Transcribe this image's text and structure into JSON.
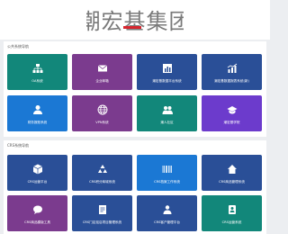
{
  "brand": {
    "logo_text": "潮宏基集团"
  },
  "sections": [
    {
      "title": "公共系统导航",
      "tiles": [
        {
          "label": "OA系统",
          "icon": "org-chart-icon",
          "color": "#12877a"
        },
        {
          "label": "企业邮箱",
          "icon": "mail-icon",
          "color": "#7b3b8e"
        },
        {
          "label": "潮宏基数据平台系统",
          "icon": "bar-chart-icon",
          "color": "#2a4f97"
        },
        {
          "label": "潮宏基数据报表系统(新)",
          "icon": "trend-chart-icon",
          "color": "#2a4f97"
        },
        {
          "label": "财务报账系统",
          "icon": "finance-user-icon",
          "color": "#1b78d4"
        },
        {
          "label": "VPN系统",
          "icon": "globe-icon",
          "color": "#7b3b8e"
        },
        {
          "label": "潮人社区",
          "icon": "users-icon",
          "color": "#12877a"
        },
        {
          "label": "潮宏基学院",
          "icon": "graduation-cap-icon",
          "color": "#6c3bcc"
        }
      ]
    },
    {
      "title": "CRS系统导航",
      "tiles": [
        {
          "label": "CRS运营平台",
          "icon": "box-icon",
          "color": "#2a4f97"
        },
        {
          "label": "CRS积分商城系统",
          "icon": "recycle-icon",
          "color": "#2a4f97"
        },
        {
          "label": "CRS档案工作系统",
          "icon": "barcode-icon",
          "color": "#1b78d4"
        },
        {
          "label": "CRS商品管理系统",
          "icon": "home-icon",
          "color": "#2a4f97"
        },
        {
          "label": "CRS商品模版工具",
          "icon": "chat-icon",
          "color": "#7b3b8e"
        },
        {
          "label": "CRS门店巡店项目管理系统",
          "icon": "document-icon",
          "color": "#2a4f97"
        },
        {
          "label": "CRS客户管理平台",
          "icon": "team-icon",
          "color": "#2a4f97"
        },
        {
          "label": "CRS运营系统",
          "icon": "contacts-icon",
          "color": "#12877a"
        }
      ]
    }
  ]
}
